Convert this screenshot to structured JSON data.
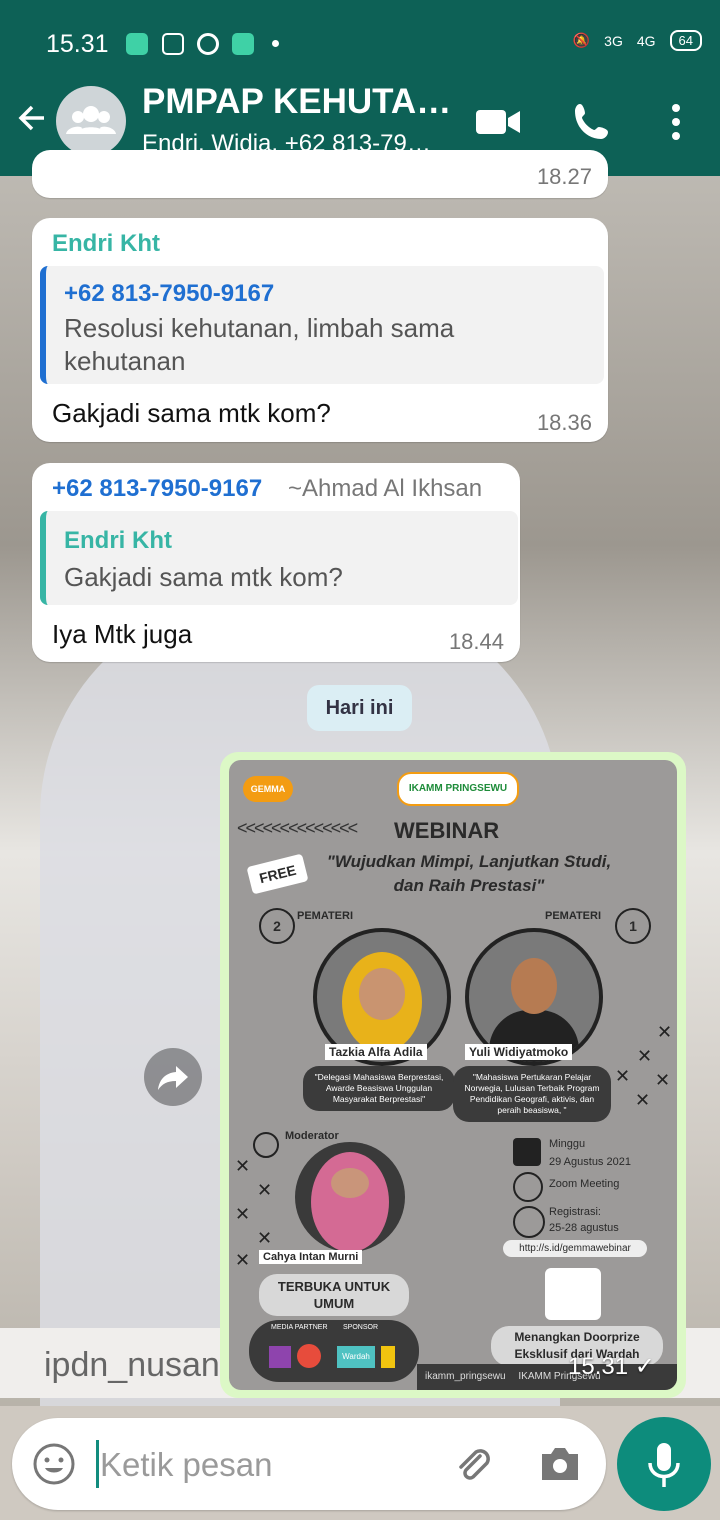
{
  "status_bar": {
    "time": "15.31",
    "net1": "3G",
    "net2": "4G",
    "battery": "64"
  },
  "header": {
    "title": "PMPAP KEHUTA…",
    "subtitle": "Endri, Widia, +62 813-79…"
  },
  "prev_message": {
    "time": "18.27"
  },
  "messages": [
    {
      "sender": "Endri Kht",
      "quote_name": "+62 813-7950-9167",
      "quote_text": "Resolusi kehutanan, limbah sama kehutanan",
      "text": "Gakjadi sama mtk kom?",
      "time": "18.36"
    },
    {
      "sender": "+62 813-7950-9167",
      "sender_alias": "~Ahmad Al Ikhsan",
      "quote_name": "Endri Kht",
      "quote_text": "Gakjadi sama mtk kom?",
      "text": "Iya Mtk juga",
      "time": "18.44"
    }
  ],
  "date_divider": "Hari ini",
  "image_message": {
    "time": "15.31",
    "poster": {
      "logo_left": "GEMMA",
      "logo_right": "IKAMM PRINGSEWU",
      "heading": "WEBINAR",
      "free_tag": "FREE",
      "quote": "\"Wujudkan Mimpi, Lanjutkan Studi, dan Raih Prestasi\"",
      "speaker_label": "PEMATERI",
      "speaker2_num": "2",
      "speaker1_num": "1",
      "speaker2_name": "Tazkia Alfa Adila",
      "speaker2_desc": "\"Delegasi Mahasiswa Berprestasi, Awarde Beasiswa Unggulan Masyarakat Berprestasi\"",
      "speaker1_name": "Yuli Widiyatmoko",
      "speaker1_desc": "\"Mahasiswa Pertukaran Pelajar Norwegia, Lulusan Terbaik Program Pendidikan Geografi, aktivis, dan peraih beasiswa, \"",
      "moderator_label": "Moderator",
      "moderator_name": "Cahya Intan Murni",
      "open_label": "TERBUKA UNTUK UMUM",
      "day": "Minggu",
      "date": "29 Agustus 2021",
      "platform": "Zoom Meeting",
      "registration": "Registrasi:",
      "registration_dates": "25-28 agustus",
      "link": "http://s.id/gemmawebinar",
      "media_partner": "MEDIA PARTNER",
      "sponsor": "SPONSOR",
      "sponsor_name": "Wardah",
      "doorprize": "Menangkan Doorprize Eksklusif dari Wardah",
      "social": "ikamm_pringsewu",
      "youtube": "IKAMM Pringsewu"
    }
  },
  "wallpaper_text": "ipdn_nusan",
  "input": {
    "placeholder": "Ketik pesan"
  },
  "colors": {
    "header": "#0d6156",
    "accent_green": "#128c7e",
    "link_blue": "#1f6fd1",
    "teal_name": "#37b5a5"
  }
}
